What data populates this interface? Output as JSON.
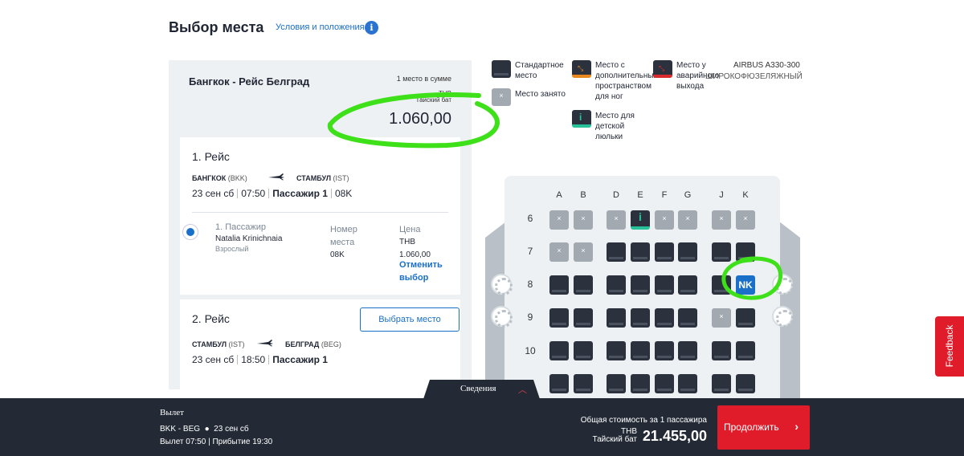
{
  "header": {
    "title": "Выбор места",
    "terms_link": "Условия и положения",
    "info_icon": "info-icon"
  },
  "summary": {
    "route": "Бангкок - Рейс Белград",
    "seats_sum": "1 место в сумме",
    "currency_code": "THB",
    "currency_name": "Тайский бат",
    "total": "1.060,00"
  },
  "flight1": {
    "title": "1. Рейс",
    "from_city": "БАНГКОК",
    "from_code": "(BKK)",
    "to_city": "СТАМБУЛ",
    "to_code": "(IST)",
    "date": "23 сен сб",
    "time": "07:50",
    "passenger_label": "Пассажир 1",
    "seat": "08K"
  },
  "passenger": {
    "label": "1. Пассажир",
    "name": "Natalia Krinichnaia",
    "type": "Взрослый",
    "seat_col_label": "Номер места",
    "seat_value": "08K",
    "price_col_label": "Цена",
    "price_currency": "THB",
    "price_value": "1.060,00",
    "cancel": "Отменить выбор"
  },
  "flight2": {
    "title": "2. Рейс",
    "pick_button": "Выбрать место",
    "from_city": "СТАМБУЛ",
    "from_code": "(IST)",
    "to_city": "БЕЛГРАД",
    "to_code": "(BEG)",
    "date": "23 сен сб",
    "time": "18:50",
    "passenger_label": "Пассажир 1"
  },
  "legend": {
    "standard": "Стандартное место",
    "occupied": "Место занято",
    "extra_leg": "Место с дополнительным пространством для ног",
    "exit": "Место у аварийного выхода",
    "bassinet": "Место для детской люльки"
  },
  "aircraft": {
    "model": "AIRBUS A330-300",
    "body": "ШИРОКОФЮЗЕЛЯЖНЫЙ"
  },
  "seatmap": {
    "columns": [
      "A",
      "B",
      "D",
      "E",
      "F",
      "G",
      "J",
      "K"
    ],
    "rows": [
      "6",
      "7",
      "8",
      "9",
      "10"
    ],
    "selected_label": "NK"
  },
  "details_tab": {
    "label": "Сведения"
  },
  "bottom": {
    "departure_label": "Вылет",
    "route": "BKK - BEG",
    "date": "23 сен сб",
    "times": "Вылет 07:50 | Прибытие 19:30",
    "total_label": "Общая стоимость за 1 пассажира",
    "currency_code": "THB",
    "currency_name": "Тайский бат",
    "total": "21.455,00",
    "continue": "Продолжить"
  },
  "feedback": "Feedback",
  "colors": {
    "accent": "#1a6fc9",
    "primary_button": "#e01c2b",
    "dark_bar": "#232a36",
    "seat_standard": "#2b323d",
    "seat_occupied": "#a3a9b1",
    "extra_leg": "#e8871c",
    "exit": "#d92b2b",
    "bassinet": "#27c29a",
    "annotation_green": "#3ee019",
    "annotation_blue": "#1e5fd6"
  }
}
